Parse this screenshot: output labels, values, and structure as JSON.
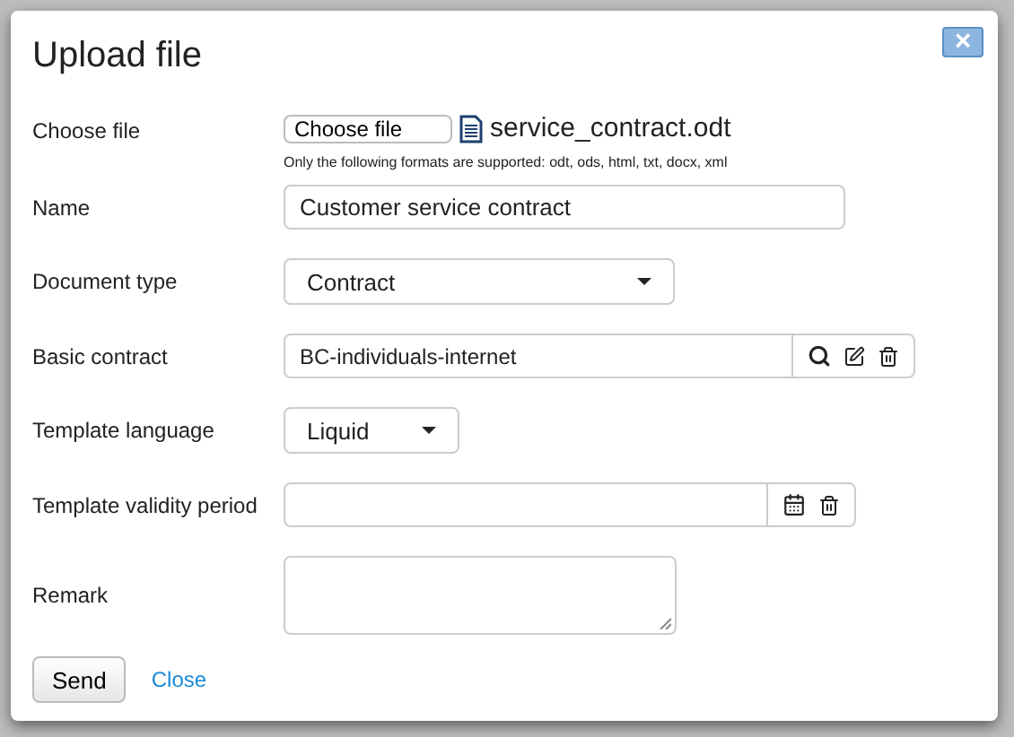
{
  "dialog": {
    "title": "Upload file",
    "close_icon": "×"
  },
  "fields": [
    {
      "kind": "file",
      "label": "Choose file",
      "button": "Choose file",
      "file_name": "service_contract.odt",
      "hint": "Only the following formats are supported: odt, ods, html, txt, docx, xml"
    },
    {
      "kind": "text",
      "label": "Name",
      "value": "Customer service contract"
    },
    {
      "kind": "select",
      "label": "Document type",
      "value": "Contract"
    },
    {
      "kind": "lookup",
      "label": "Basic contract",
      "value": "BC-individuals-internet"
    },
    {
      "kind": "select_small",
      "label": "Template language",
      "value": "Liquid"
    },
    {
      "kind": "date",
      "label": "Template validity period"
    },
    {
      "kind": "textarea",
      "label": "Remark"
    }
  ],
  "buttons": {
    "primary": "Send",
    "link": "Close"
  }
}
